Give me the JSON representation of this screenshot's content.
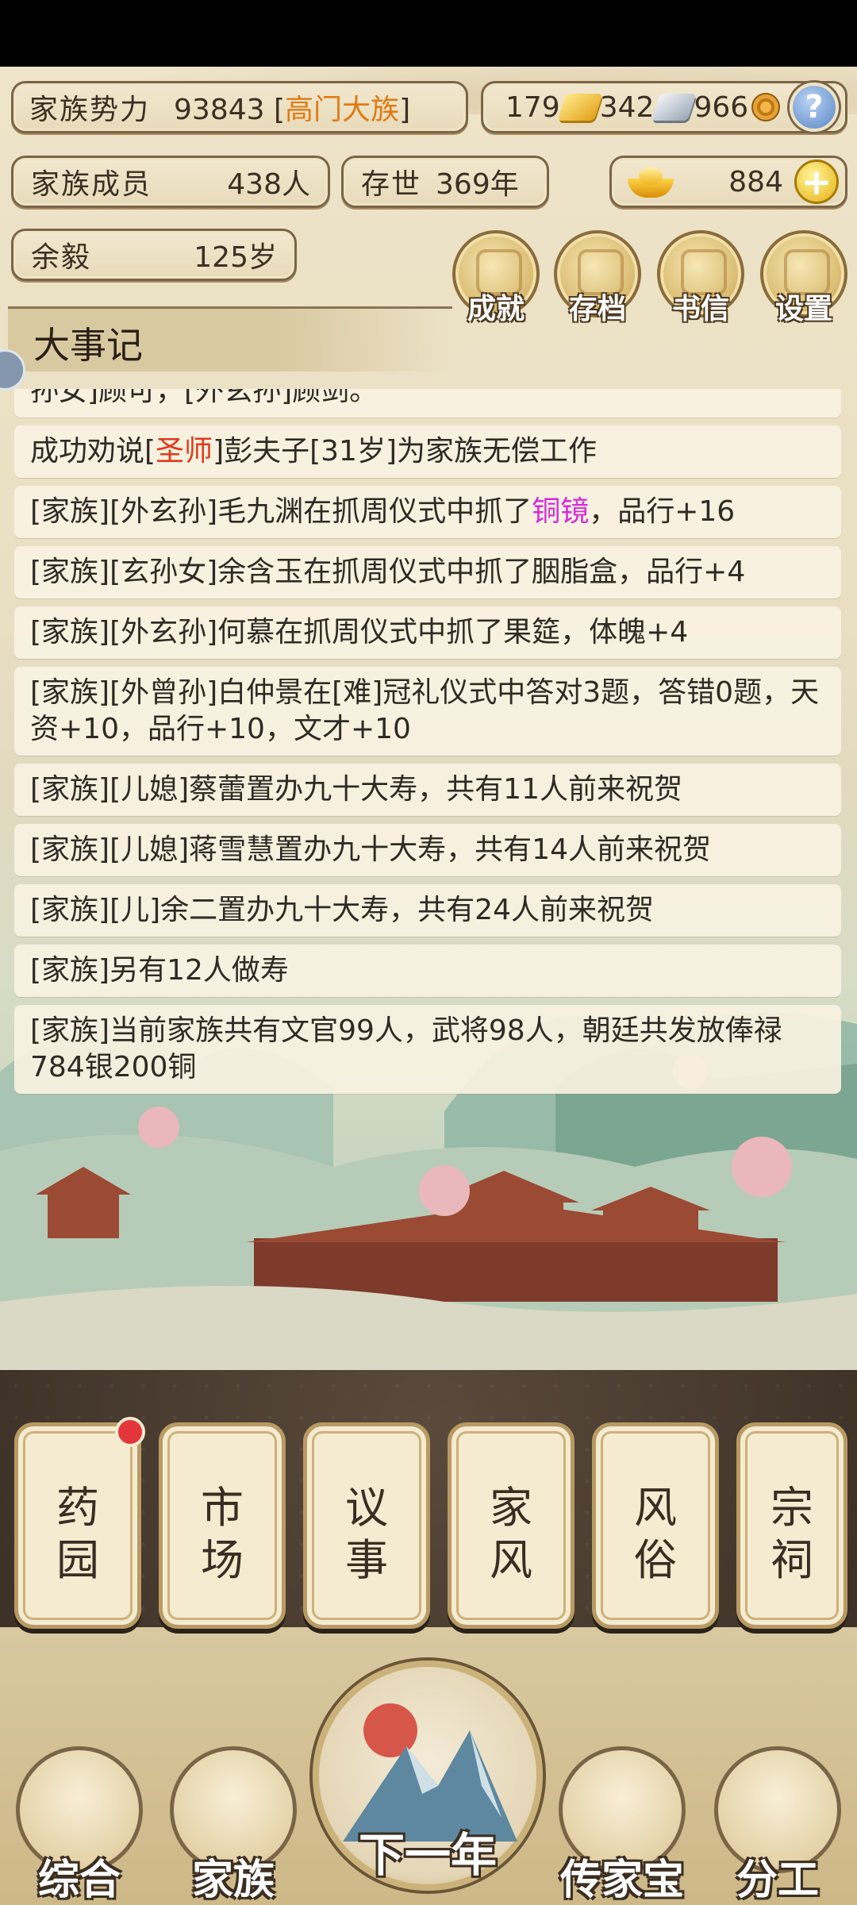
{
  "status": {
    "power_label": "家族势力",
    "power_value": "93843",
    "rank_open": "[",
    "rank": "高门大族",
    "rank_close": "]",
    "gold": "179",
    "silver": "342",
    "coins": "966",
    "help": "?",
    "members_label": "家族成员",
    "members_value": "438人",
    "years_label": "存世",
    "years_value": "369年",
    "ingots": "884",
    "name": "余毅",
    "age": "125岁"
  },
  "top_menu": [
    {
      "label": "成就",
      "icon": "achievement-icon"
    },
    {
      "label": "存档",
      "icon": "save-icon"
    },
    {
      "label": "书信",
      "icon": "letter-icon"
    },
    {
      "label": "设置",
      "icon": "settings-icon"
    }
  ],
  "events_title": "大事记",
  "events": {
    "e0": "孙女]顾可，[外玄孙]顾剑。",
    "e1_a": "成功劝说[",
    "e1_red": "圣师",
    "e1_b": "]彭夫子[31岁]为家族无偿工作",
    "e2_a": "[家族][外玄孙]毛九渊在抓周仪式中抓了",
    "e2_mag": "铜镜",
    "e2_b": "，品行+16",
    "e3": "[家族][玄孙女]余含玉在抓周仪式中抓了胭脂盒，品行+4",
    "e4": "[家族][外玄孙]何慕在抓周仪式中抓了果筵，体魄+4",
    "e5": "[家族][外曾孙]白仲景在[难]冠礼仪式中答对3题，答错0题，天资+10，品行+10，文才+10",
    "e6": "[家族][儿媳]蔡蕾置办九十大寿，共有11人前来祝贺",
    "e7": "[家族][儿媳]蒋雪慧置办九十大寿，共有14人前来祝贺",
    "e8": "[家族][儿]余二置办九十大寿，共有24人前来祝贺",
    "e9": "[家族]另有12人做寿",
    "e10": "[家族]当前家族共有文官99人，武将98人，朝廷共发放俸禄784银200铜"
  },
  "cards": [
    {
      "label": "药园",
      "badge": true
    },
    {
      "label": "市场",
      "badge": false
    },
    {
      "label": "议事",
      "badge": false
    },
    {
      "label": "家风",
      "badge": false
    },
    {
      "label": "风俗",
      "badge": false
    },
    {
      "label": "宗祠",
      "badge": false
    }
  ],
  "bottom_nav": {
    "overview": "综合",
    "family": "家族",
    "next_year": "下一年",
    "heirloom": "传家宝",
    "division": "分工"
  },
  "colors": {
    "rank": "#e07a11",
    "highlight_red": "#e0391b",
    "highlight_magenta": "#d629d8",
    "badge": "#e2363b"
  }
}
